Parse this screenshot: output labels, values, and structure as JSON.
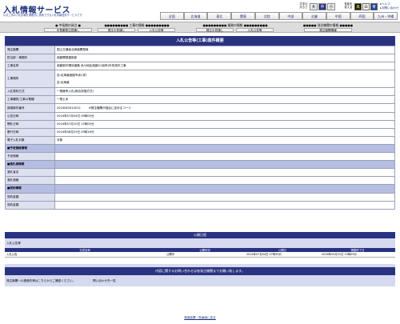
{
  "header": {
    "title": "入札情報サービス",
    "subtitle": "公共工事の入札情報を横断的に検索できる入札情報提供サービスです",
    "text_size": {
      "label_line1": "文字の",
      "label_line2": "大きさ",
      "options": [
        "大",
        "中",
        "小"
      ]
    },
    "color_set": {
      "label_line1": "背景を",
      "label_line2": "変える",
      "options": [
        "黒",
        "白",
        "青"
      ]
    },
    "help_links": [
      "ヘルプ",
      "お問い合わせ"
    ]
  },
  "region_nav": [
    "全国",
    "北海道",
    "東北",
    "関東",
    "北陸",
    "中部",
    "近畿",
    "中国",
    "四国",
    "九州・沖縄"
  ],
  "top_nav": [
    {
      "title": "中長期の発注",
      "items": [
        "中長期発注見通し"
      ]
    },
    {
      "title": "工事の情報",
      "items": [
        "発注の見通し",
        "入札公告等"
      ]
    },
    {
      "title": "業務の情報",
      "items": [
        "発注の見通し",
        "入札公告等"
      ]
    },
    {
      "title": "発注機関の情報",
      "items": [
        "発注機関情報"
      ]
    }
  ],
  "section_title": "入札公告等(工事)案件概要",
  "detail_rows": [
    {
      "key": "発注機関",
      "value": "国土交通省北海道開発局"
    },
    {
      "key": "担当部・事務所",
      "value": "函館開発建設部"
    },
    {
      "key": "工事名称",
      "value": "函館新外環状道路 赤川地区函館IC(仮称)外改良外工事"
    },
    {
      "key": "工事場所",
      "value": "自:北海道函館市赤川町",
      "value2": "至:北海道",
      "tall": true
    },
    {
      "key": "入札契約方式",
      "value": "一般競争入札(総合評価方式)"
    },
    {
      "key": "工事種別/工事の業種",
      "value": "一般土木"
    },
    {
      "key": "調達案件番号",
      "value": "2024062010012",
      "note": "※発注機関が独自に定めるコード"
    },
    {
      "key": "公告日時",
      "value": "2024年07月04日 09時00分"
    },
    {
      "key": "開札日時",
      "value": "2024年07月10日 12時00分"
    },
    {
      "key": "履行日時",
      "value": "2024年08月29日 09時16分"
    },
    {
      "key": "電子入札対象",
      "value": "対象"
    },
    {
      "key": "■予定価格情報",
      "value": "",
      "group": true
    },
    {
      "key": "予定価格",
      "value": ""
    },
    {
      "key": "■落札者情報",
      "value": "",
      "group": true
    },
    {
      "key": "落札者名",
      "value": ""
    },
    {
      "key": "落札価格",
      "value": ""
    },
    {
      "key": "■契約情報",
      "value": "",
      "group": true
    },
    {
      "key": "契約金額",
      "value": ""
    },
    {
      "key": "契約金額",
      "value": ""
    }
  ],
  "publication": {
    "title": "公開日程",
    "attach_label": "入札公告等",
    "columns": [
      "文書名称",
      "公開状況",
      "公開日",
      "掲載終了日"
    ],
    "rows": [
      {
        "name": "入札公告",
        "status": "公開中",
        "start": "2024年07月04日 07時30分",
        "end": "2026年03月31日 23時59分"
      }
    ],
    "other_label": "入札公告等・その他",
    "other_value": "該当データはありません"
  },
  "contact": {
    "title": "内容に関するお問い合わせは各発注機関までお願い致します。",
    "line1": "発注機関への連絡先等はこちらからご確認ください。",
    "line2": "問い合わせ先一覧"
  },
  "back_link": "検索結果一覧画面に戻る",
  "colors": {
    "primary": "#2a3380",
    "label_bg": "#dde0ef",
    "group_bg": "#b6bde2"
  }
}
